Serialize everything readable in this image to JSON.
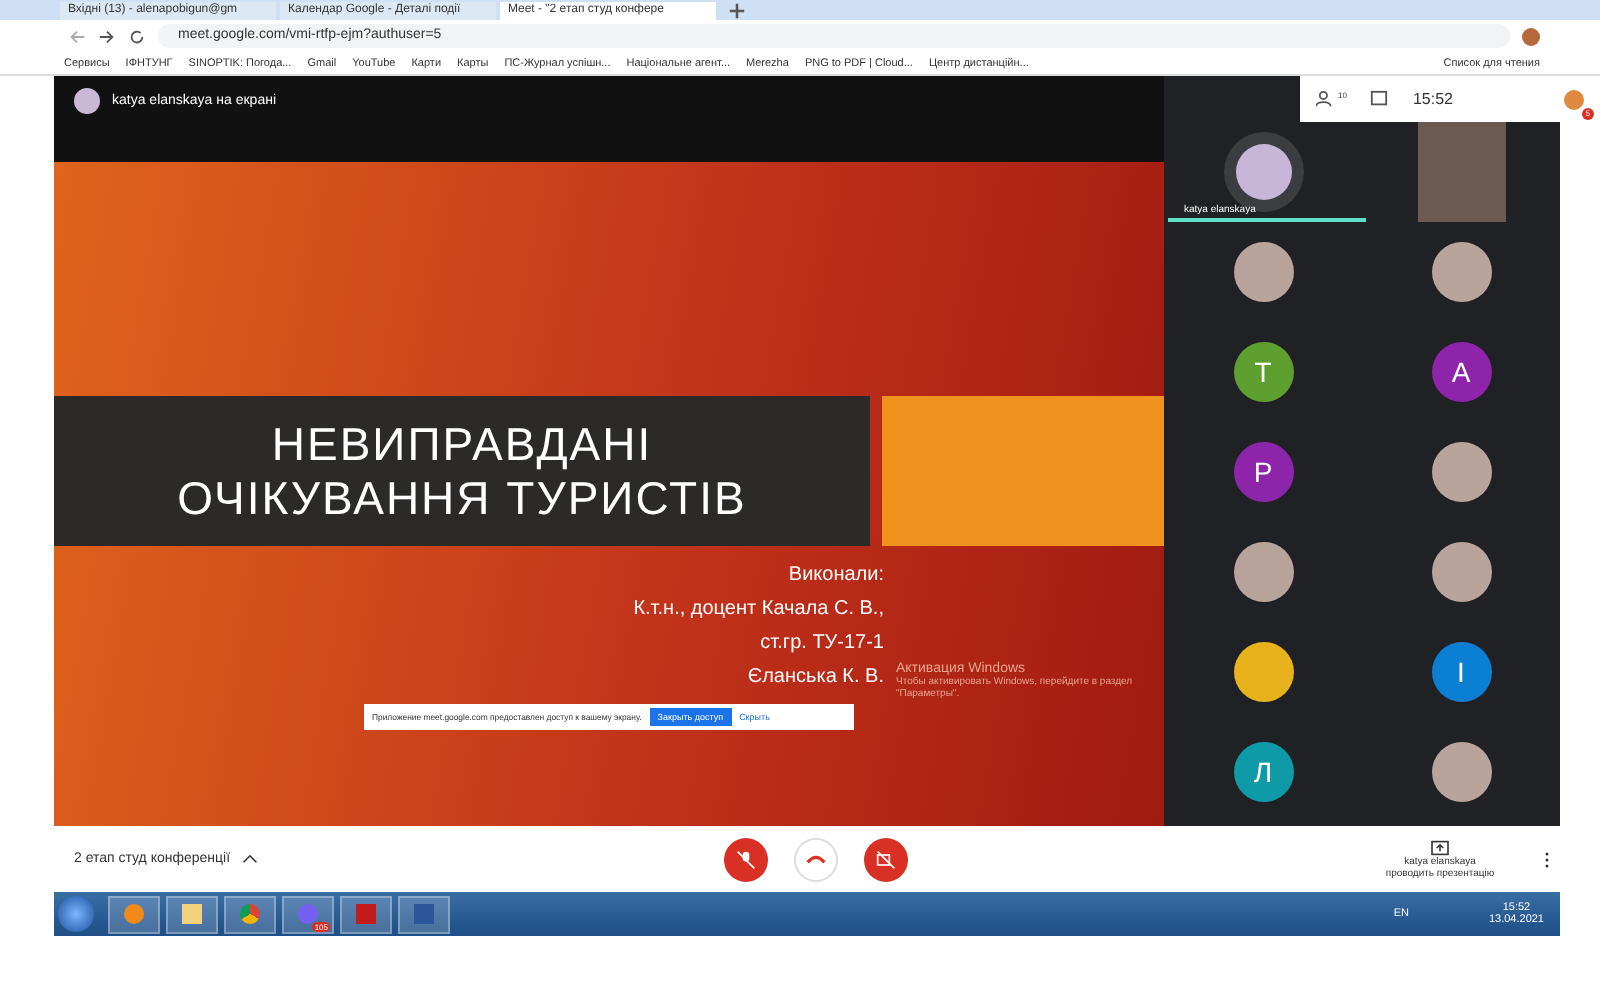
{
  "browser": {
    "tabs": [
      {
        "title": "Вхідні (13) - alenapobigun@gm",
        "selected": false
      },
      {
        "title": "Календар Google - Деталі події",
        "selected": false
      },
      {
        "title": "Meet - \"2 етап студ конфере",
        "selected": true
      }
    ],
    "url": "meet.google.com/vmi-rtfp-ejm?authuser=5",
    "bookmarks": [
      "Сервисы",
      "ІФНТУНГ",
      "SINOPTIK: Погода...",
      "Gmail",
      "YouTube",
      "Карти",
      "Карты",
      "ПС-Журнал успішн...",
      "Національне агент...",
      "Merezha",
      "PNG to PDF | Cloud...",
      "Центр дистанційн..."
    ],
    "reading_list": "Список для чтения"
  },
  "meet": {
    "presenter_label": "katya elanskaya на екрані",
    "toolbar": {
      "participants_count": "10",
      "time": "15:52",
      "badge": "5"
    },
    "slide": {
      "title_lines": [
        "НЕВИПРАВДАНІ",
        "ОЧІКУВАННЯ ТУРИСТІВ"
      ],
      "credits": [
        "Виконали:",
        "К.т.н., доцент Качала С. В.,",
        "ст.гр. ТУ-17-1",
        "Єланська К. В."
      ]
    },
    "share_notice": {
      "text": "Приложение meet.google.com предоставлен доступ к вашему экрану.",
      "button": "Закрыть доступ",
      "link": "Скрыть"
    },
    "activation": {
      "title": "Активация Windows",
      "text": "Чтобы активировать Windows, перейдите в раздел \"Параметры\"."
    },
    "tiles": [
      {
        "kind": "speaker",
        "name": "katya elanskaya",
        "speaking": true
      },
      {
        "kind": "video"
      },
      {
        "kind": "photo"
      },
      {
        "kind": "photo"
      },
      {
        "kind": "letter",
        "letter": "T",
        "color": "#5e9e2e"
      },
      {
        "kind": "letter",
        "letter": "A",
        "color": "#8e24aa"
      },
      {
        "kind": "letter",
        "letter": "P",
        "color": "#8e24aa"
      },
      {
        "kind": "photo"
      },
      {
        "kind": "photo"
      },
      {
        "kind": "photo"
      },
      {
        "kind": "emblem"
      },
      {
        "kind": "letter",
        "letter": "І",
        "color": "#0b7fd4"
      },
      {
        "kind": "letter",
        "letter": "Л",
        "color": "#0f9aa8"
      },
      {
        "kind": "photo"
      }
    ],
    "meeting_title": "2 етап студ конференції",
    "controls": [
      {
        "kind": "mic"
      },
      {
        "kind": "hangup"
      },
      {
        "kind": "camera"
      }
    ],
    "presenting_lines": [
      "katya elanskaya",
      "проводить презентацію"
    ]
  },
  "taskbar": {
    "apps": [
      {
        "kind": "player"
      },
      {
        "kind": "folder"
      },
      {
        "kind": "chrome"
      },
      {
        "kind": "viber",
        "badge": "105"
      },
      {
        "kind": "pdf"
      },
      {
        "kind": "word"
      }
    ],
    "lang": "EN",
    "time": "15:52",
    "date": "13.04.2021"
  }
}
